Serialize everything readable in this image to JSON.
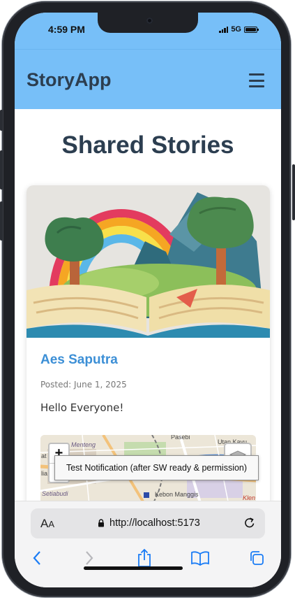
{
  "status_bar": {
    "time": "4:59 PM",
    "network": "5G"
  },
  "header": {
    "brand": "StoryApp",
    "menu_icon": "hamburger-menu-icon"
  },
  "page": {
    "title": "Shared Stories"
  },
  "story": {
    "author": "Aes Saputra",
    "date": "Posted: June 1, 2025",
    "description": "Hello Everyone!",
    "image_icon": "open-book-illustration",
    "map": {
      "zoom_in": "+",
      "zoom_out": "−",
      "labels": {
        "menteng": "Menteng",
        "pasebi": "Pasebi",
        "utan_kayu": "Utan Kayu",
        "setiabudi": "Setiabudi",
        "kebon_manggis": "Kebon Manggis",
        "klender": "Klen",
        "at": "at",
        "lia": "lia"
      },
      "layers_icon": "layers-icon"
    }
  },
  "tooltip": {
    "text": "Test Notification (after SW ready & permission)"
  },
  "safari": {
    "aa_large": "A",
    "aa_small": "A",
    "url": "http://localhost:5173",
    "lock_icon": "lock-icon",
    "reload_icon": "reload-icon",
    "toolbar_icons": [
      "back-icon",
      "forward-icon",
      "share-icon",
      "bookmarks-icon",
      "tabs-icon"
    ]
  },
  "colors": {
    "header_bg": "#77bff8",
    "brand_text": "#2c3e50",
    "author_link": "#3c8fd6"
  }
}
